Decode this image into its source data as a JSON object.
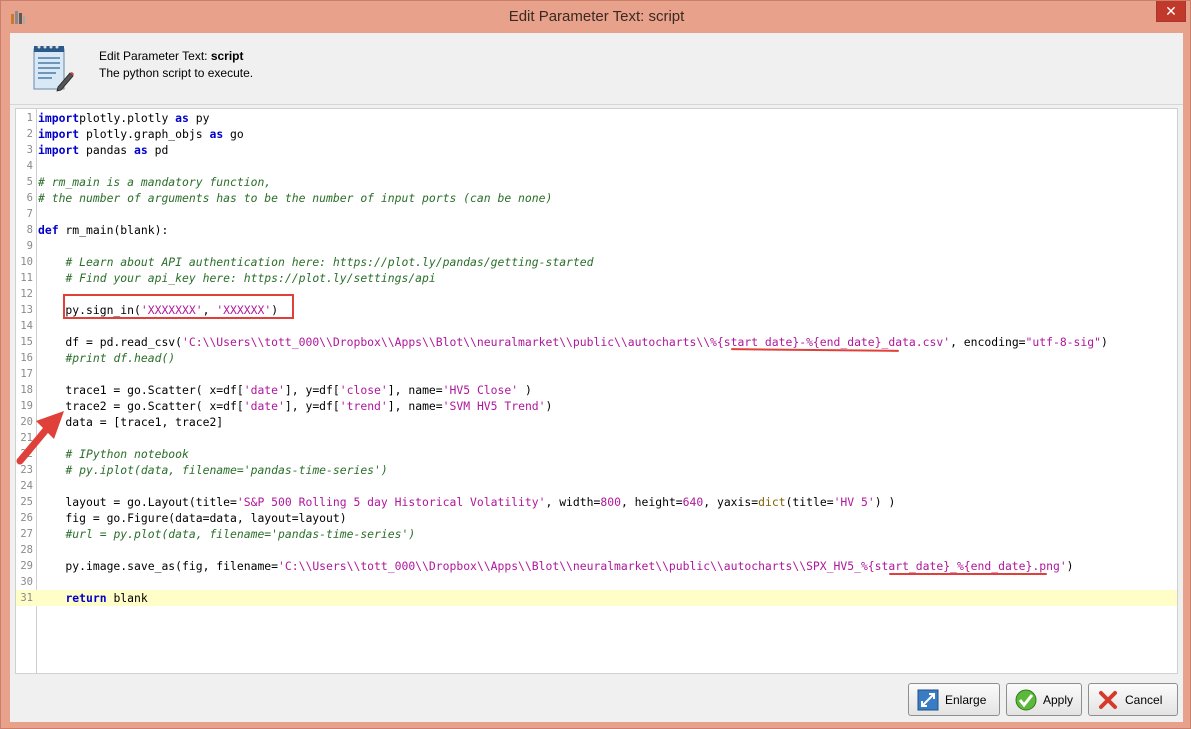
{
  "window": {
    "title": "Edit Parameter Text: script",
    "close_glyph": "✕"
  },
  "header": {
    "title_prefix": "Edit Parameter Text: ",
    "title_param": "script",
    "description": "The python script to execute."
  },
  "editor": {
    "highlight_color": "#fffdc8",
    "lines": [
      {
        "n": "1",
        "c": [
          [
            "kw",
            "import"
          ],
          [
            "",
            "plotly.plotly "
          ],
          [
            "kw",
            "as"
          ],
          [
            "",
            " py"
          ]
        ]
      },
      {
        "n": "2",
        "c": [
          [
            "kw",
            "import"
          ],
          [
            "",
            " plotly.graph_objs "
          ],
          [
            "kw",
            "as"
          ],
          [
            "",
            " go"
          ]
        ]
      },
      {
        "n": "3",
        "c": [
          [
            "kw",
            "import"
          ],
          [
            "",
            " pandas "
          ],
          [
            "kw",
            "as"
          ],
          [
            "",
            " pd"
          ]
        ]
      },
      {
        "n": "4",
        "c": []
      },
      {
        "n": "5",
        "c": [
          [
            "cm",
            "# rm_main is a mandatory function,"
          ]
        ]
      },
      {
        "n": "6",
        "c": [
          [
            "cm",
            "# the number of arguments has to be the number of input ports (can be none)"
          ]
        ]
      },
      {
        "n": "7",
        "c": []
      },
      {
        "n": "8",
        "c": [
          [
            "kw",
            "def"
          ],
          [
            "",
            " rm_main(blank):"
          ]
        ]
      },
      {
        "n": "9",
        "c": []
      },
      {
        "n": "10",
        "c": [
          [
            "",
            "    "
          ],
          [
            "cm",
            "# Learn about API authentication here: https://plot.ly/pandas/getting-started"
          ]
        ]
      },
      {
        "n": "11",
        "c": [
          [
            "",
            "    "
          ],
          [
            "cm",
            "# Find your api_key here: https://plot.ly/settings/api"
          ]
        ]
      },
      {
        "n": "12",
        "c": []
      },
      {
        "n": "13",
        "c": [
          [
            "",
            "    py.sign_in("
          ],
          [
            "st",
            "'XXXXXXX'"
          ],
          [
            "",
            ", "
          ],
          [
            "st",
            "'XXXXXX'"
          ],
          [
            "",
            ")"
          ]
        ]
      },
      {
        "n": "14",
        "c": []
      },
      {
        "n": "15",
        "c": [
          [
            "",
            "    df = pd.read_csv("
          ],
          [
            "st",
            "'C:\\\\Users\\\\tott_000\\\\Dropbox\\\\Apps\\\\Blot\\\\neuralmarket\\\\public\\\\autocharts\\\\%{start_date}-%{end_date}_data.csv'"
          ],
          [
            "",
            ", encoding="
          ],
          [
            "st",
            "\"utf-8-sig\""
          ],
          [
            "",
            ")"
          ]
        ]
      },
      {
        "n": "16",
        "c": [
          [
            "",
            "    "
          ],
          [
            "cm",
            "#print df.head()"
          ]
        ]
      },
      {
        "n": "17",
        "c": []
      },
      {
        "n": "18",
        "c": [
          [
            "",
            "    trace1 = go.Scatter( x=df["
          ],
          [
            "st",
            "'date'"
          ],
          [
            "",
            "], y=df["
          ],
          [
            "st",
            "'close'"
          ],
          [
            "",
            "], name="
          ],
          [
            "st",
            "'HV5 Close'"
          ],
          [
            "",
            " )"
          ]
        ]
      },
      {
        "n": "19",
        "c": [
          [
            "",
            "    trace2 = go.Scatter( x=df["
          ],
          [
            "st",
            "'date'"
          ],
          [
            "",
            "], y=df["
          ],
          [
            "st",
            "'trend'"
          ],
          [
            "",
            "], name="
          ],
          [
            "st",
            "'SVM HV5 Trend'"
          ],
          [
            "",
            ")"
          ]
        ]
      },
      {
        "n": "20",
        "c": [
          [
            "",
            "    data = [trace1, trace2]"
          ]
        ]
      },
      {
        "n": "21",
        "c": []
      },
      {
        "n": "22",
        "c": [
          [
            "",
            "    "
          ],
          [
            "cm",
            "# IPython notebook"
          ]
        ]
      },
      {
        "n": "23",
        "c": [
          [
            "",
            "    "
          ],
          [
            "cm",
            "# py.iplot(data, filename='pandas-time-series')"
          ]
        ]
      },
      {
        "n": "24",
        "c": []
      },
      {
        "n": "25",
        "c": [
          [
            "",
            "    layout = go.Layout(title="
          ],
          [
            "st",
            "'S&P 500 Rolling 5 day Historical Volatility'"
          ],
          [
            "",
            ", width="
          ],
          [
            "num",
            "800"
          ],
          [
            "",
            ", height="
          ],
          [
            "num",
            "640"
          ],
          [
            "",
            ", yaxis="
          ],
          [
            "fn",
            "dict"
          ],
          [
            "",
            "(title="
          ],
          [
            "st",
            "'HV 5'"
          ],
          [
            "",
            ") )"
          ]
        ]
      },
      {
        "n": "26",
        "c": [
          [
            "",
            "    fig = go.Figure(data=data, layout=layout)"
          ]
        ]
      },
      {
        "n": "27",
        "c": [
          [
            "",
            "    "
          ],
          [
            "cm",
            "#url = py.plot(data, filename='pandas-time-series')"
          ]
        ]
      },
      {
        "n": "28",
        "c": []
      },
      {
        "n": "29",
        "c": [
          [
            "",
            "    py.image.save_as(fig, filename="
          ],
          [
            "st",
            "'C:\\\\Users\\\\tott_000\\\\Dropbox\\\\Apps\\\\Blot\\\\neuralmarket\\\\public\\\\autocharts\\\\SPX_HV5_%{start_date}_%{end_date}.png'"
          ],
          [
            "",
            ")"
          ]
        ]
      },
      {
        "n": "30",
        "c": []
      },
      {
        "n": "31",
        "c": [
          [
            "",
            "    "
          ],
          [
            "kw",
            "return"
          ],
          [
            "",
            " blank"
          ]
        ]
      }
    ]
  },
  "buttons": {
    "enlarge": "Enlarge",
    "apply": "Apply",
    "cancel": "Cancel"
  },
  "annotation_color": "#e0403a"
}
